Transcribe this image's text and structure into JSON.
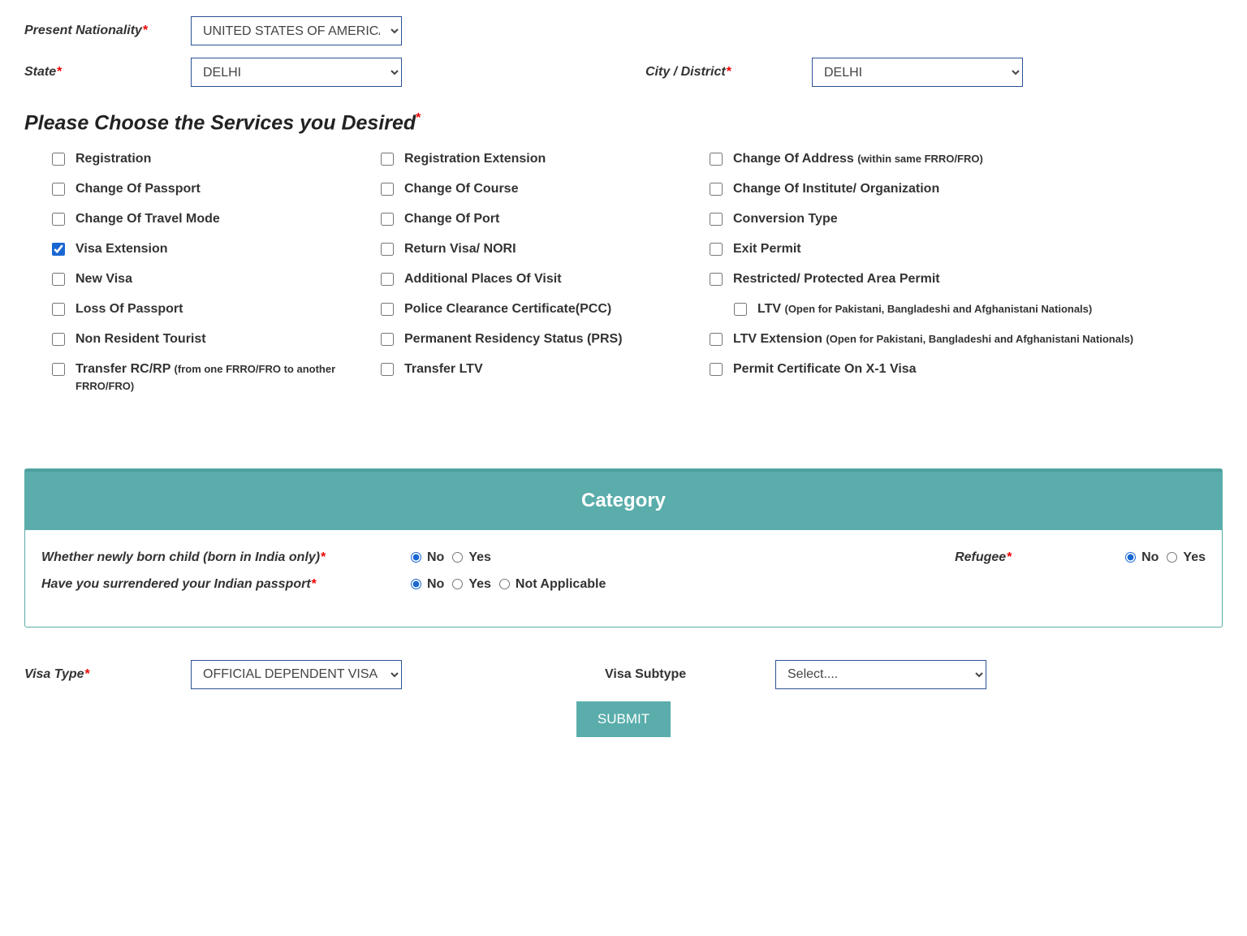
{
  "top": {
    "nationality_label": "Present Nationality",
    "nationality_value": "UNITED STATES OF AMERICA",
    "state_label": "State",
    "state_value": "DELHI",
    "city_label": "City / District",
    "city_value": "DELHI"
  },
  "services_header": "Please Choose the Services you Desired",
  "services_header_star": "*",
  "services": [
    {
      "label": "Registration",
      "checked": false
    },
    {
      "label": "Registration Extension",
      "checked": false
    },
    {
      "label": "Change Of Address",
      "note": "(within same FRRO/FRO)",
      "checked": false
    },
    {
      "label": "Change Of Passport",
      "checked": false
    },
    {
      "label": "Change Of Course",
      "checked": false
    },
    {
      "label": "Change Of Institute/ Organization",
      "checked": false
    },
    {
      "label": "Change Of Travel Mode",
      "checked": false
    },
    {
      "label": "Change Of Port",
      "checked": false
    },
    {
      "label": "Conversion Type",
      "checked": false
    },
    {
      "label": "Visa Extension",
      "checked": true
    },
    {
      "label": "Return Visa/ NORI",
      "checked": false
    },
    {
      "label": "Exit Permit",
      "checked": false
    },
    {
      "label": "New Visa",
      "checked": false
    },
    {
      "label": "Additional Places Of Visit",
      "checked": false
    },
    {
      "label": "Restricted/ Protected Area Permit",
      "checked": false
    },
    {
      "label": "Loss Of Passport",
      "checked": false
    },
    {
      "label": "Police Clearance Certificate(PCC)",
      "checked": false
    },
    {
      "label": "LTV",
      "note": "(Open for Pakistani, Bangladeshi and Afghanistani Nationals)",
      "checked": false,
      "indent": true
    },
    {
      "label": "Non Resident Tourist",
      "checked": false
    },
    {
      "label": "Permanent Residency Status (PRS)",
      "checked": false
    },
    {
      "label": "LTV Extension",
      "note": "(Open for Pakistani, Bangladeshi and Afghanistani Nationals)",
      "checked": false
    },
    {
      "label": "Transfer RC/RP",
      "note": "(from one FRRO/FRO to another FRRO/FRO)",
      "checked": false
    },
    {
      "label": "Transfer LTV",
      "checked": false
    },
    {
      "label": "Permit Certificate On X-1 Visa",
      "checked": false
    }
  ],
  "category_header": "Category",
  "questions": {
    "newborn_label": "Whether newly born child  (born in India only)",
    "refugee_label": "Refugee",
    "surrendered_label": "Have you surrendered your Indian passport",
    "no": "No",
    "yes": "Yes",
    "na": "Not Applicable",
    "newborn_value": "No",
    "refugee_value": "No",
    "surrendered_value": "No"
  },
  "visa": {
    "type_label": "Visa Type",
    "type_value": "OFFICIAL DEPENDENT VISA",
    "subtype_label": "Visa Subtype",
    "subtype_value": "Select...."
  },
  "submit_label": "SUBMIT"
}
